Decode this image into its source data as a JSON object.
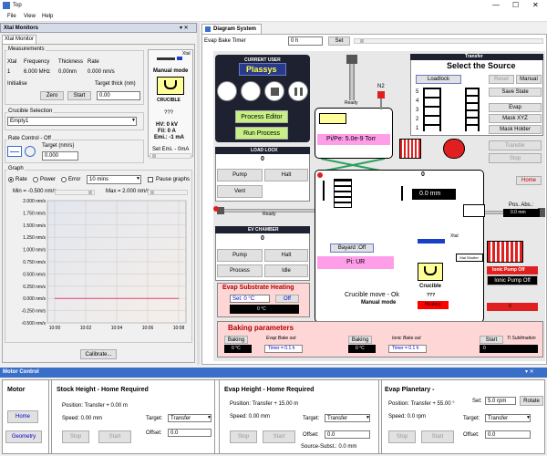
{
  "window": {
    "title": "Top"
  },
  "menu": [
    "File",
    "View",
    "Help"
  ],
  "left_pane": {
    "header": "Xtal Monitors",
    "tab": "Xtal Monitor",
    "measurements": {
      "title": "Measurements",
      "headers": [
        "Xtal",
        "Frequency",
        "Thickness",
        "Rate"
      ],
      "row": [
        "1",
        "6.000 MHz",
        "0.00nm",
        "0.000 nm/s"
      ],
      "initialise_label": "Initialise",
      "target_thick_label": "Target thick (nm)",
      "zero_btn": "Zero",
      "start_btn": "Start",
      "target_thick_value": "0.00"
    },
    "manual_mode": {
      "label": "Manual mode",
      "crucible_label": "CRUCIBLE",
      "crucible_value": "???",
      "hv": "HV: 0 kV",
      "fil": "Fil: 0 A",
      "emi": "Emi.: -1 mA",
      "set_emi": "Set Emi. - 0mA",
      "xtal_small": "Xtal"
    },
    "crucible_selection": {
      "title": "Crucible Selection",
      "value": "Empty1"
    },
    "rate_control": {
      "title": "Rate Control - Off",
      "target_label": "Target (nm/s)",
      "target_value": "0.000"
    },
    "graph": {
      "title": "Graph",
      "options": [
        "Rate",
        "Power",
        "Error"
      ],
      "duration": "10 mins",
      "pause_label": "Pause graphs",
      "min_label": "Min = -0.500 nm/s",
      "max_label": "Max = 2.000 nm/s"
    },
    "calibrate_btn": "Calibrate..."
  },
  "chart_data": {
    "type": "line",
    "y_ticks": [
      "2.000 nm/s",
      "1.750 nm/s",
      "1.500 nm/s",
      "1.250 nm/s",
      "1.000 nm/s",
      "0.750 nm/s",
      "0.500 nm/s",
      "0.250 nm/s",
      "0.000 nm/s",
      "-0.250 nm/s",
      "-0.500 nm/s"
    ],
    "x_ticks": [
      "10:00",
      "10:02",
      "10:04",
      "10:06",
      "10:08"
    ],
    "ylim": [
      -0.5,
      2.0
    ],
    "series": [
      {
        "values": [
          0,
          0,
          0,
          0,
          0,
          0,
          0,
          0,
          0,
          0
        ],
        "x": [
          "10:00",
          "10:01",
          "10:02",
          "10:03",
          "10:04",
          "10:05",
          "10:06",
          "10:07",
          "10:08",
          "10:09"
        ]
      }
    ],
    "grid": true
  },
  "diagram": {
    "tab": "Diagram System",
    "bake_timer_label": "Evap Bake Timer",
    "bake_timer_value": "0 h",
    "set_btn": "Set",
    "current_user_label": "CURRENT USER",
    "current_user": "Plassys",
    "process_editor_btn": "Process Editor",
    "run_process_btn": "Run Process",
    "load_lock": {
      "title": "LOAD LOCK",
      "value": "0",
      "pump": "Pump",
      "halt": "Halt",
      "vent": "Vent"
    },
    "ev_chamber": {
      "title": "EV CHAMBER",
      "value": "0",
      "pump": "Pump",
      "halt": "Halt",
      "process": "Process",
      "idle": "Idle"
    },
    "ready1": "Ready",
    "ready2": "Ready",
    "pi_pe": "Pi/Pe: 5.0e-9 Torr",
    "n2": "N2",
    "chamber_value": "0",
    "chamber_mm": "0.0 mm",
    "bayard": "Bayard :Off",
    "pi_ur": "Pi: UR",
    "xtal_label": "Xtal",
    "xtal_shutter": "Xtal Shutter",
    "crucible_move": "Crucible move - Ok",
    "manual_mode": "Manual mode",
    "crucible_label": "Crucible",
    "crucible_value": "???",
    "heating": "Heating",
    "evap_heating": {
      "title": "Evap Substrate Heating",
      "set": "Set: 0 °C",
      "off": "Off",
      "value": "0 °C"
    },
    "transfer": {
      "header": "Transfer",
      "title": "Select the Source",
      "loadlock": "Loadlock",
      "reset": "Reset",
      "manual": "Manual",
      "save_state": "Save State",
      "evap": "Evap",
      "mask_xyz": "Mask XYZ",
      "mask_holder": "Mask Holder",
      "transfer_btn": "Transfer",
      "stop_btn": "Stop",
      "home_btn": "Home",
      "pos_abs_label": "Pos. Abs.:",
      "pos_abs_value": "0.0 mm",
      "slots": [
        "5",
        "4",
        "3",
        "2",
        "1"
      ]
    },
    "ionic_pump_off": "Ionic Pump Off",
    "ionic_pump_off2": "Ionic Pump Off",
    "ionic_value": "0",
    "baking": {
      "title": "Baking parameters",
      "baking1": "Baking",
      "evap_bake_out": "Evap Bake out",
      "temp1": "0 °C",
      "timer1": "Timer = 0.1 h",
      "baking2": "Baking",
      "ionic_bake_out": "Ionic Bake out",
      "temp2": "0 °C",
      "timer2": "Timer = 0.1 h",
      "start": "Start",
      "ti_sub": "Ti Sublimation",
      "value": "0"
    }
  },
  "motor": {
    "header": "Motor Control",
    "motor_label": "Motor",
    "home": "Home",
    "geometry": "Geometry",
    "stock": {
      "title": "Stock Height - Home Required",
      "position": "Position: Transfer + 0.00 m",
      "speed": "Speed:  0.00 mm",
      "target_label": "Target:",
      "target_value": "Transfer",
      "offset_label": "Offset:",
      "offset_value": "0.0",
      "stop": "Stop",
      "start": "Start"
    },
    "evap_height": {
      "title": "Evap Height - Home Required",
      "position": "Position: Transfer + 15.00 m",
      "speed": "Speed:  0.00 mm",
      "target_label": "Target:",
      "target_value": "Transfer",
      "offset_label": "Offset:",
      "offset_value": "0.0",
      "source_subst": "Source-Subst.: 0.0 mm",
      "stop": "Stop",
      "start": "Start"
    },
    "evap_planetary": {
      "title": "Evap Planetary -",
      "position": "Position: Transfer + 55.00 °",
      "speed": "Speed:  0.0 rpm",
      "set_label": "Set:",
      "set_value": "5.0 rpm",
      "rotate": "Rotate",
      "target_label": "Target:",
      "target_value": "Transfer",
      "offset_label": "Offset:",
      "offset_value": "0.0",
      "stop": "Stop",
      "start": "Start"
    }
  }
}
